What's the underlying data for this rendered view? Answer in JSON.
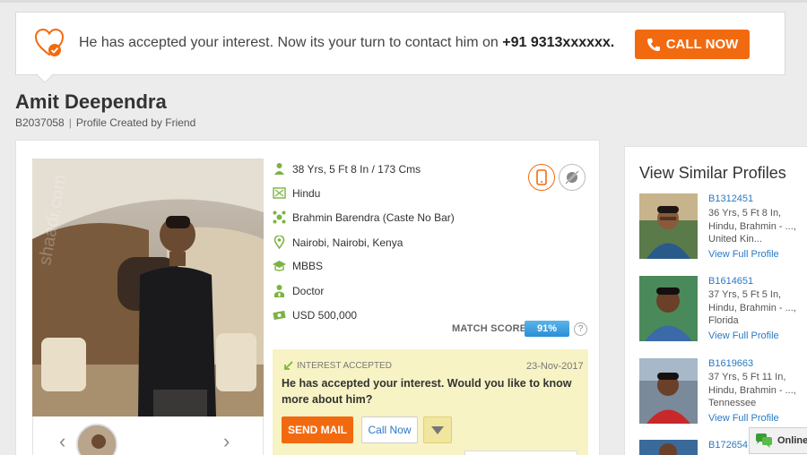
{
  "notice": {
    "text": "He has accepted your interest. Now its your turn to contact him on",
    "phone": "+91 9313xxxxxx.",
    "call_button": "CALL NOW"
  },
  "profile": {
    "name": "Amit Deependra",
    "id": "B2037058",
    "created_by": "Profile Created by Friend",
    "photo_watermark": "shaadi.com",
    "details": [
      {
        "icon": "person-icon",
        "text": "38 Yrs, 5 Ft 8 In / 173 Cms"
      },
      {
        "icon": "religion-icon",
        "text": "Hindu"
      },
      {
        "icon": "community-icon",
        "text": "Brahmin Barendra (Caste No Bar)"
      },
      {
        "icon": "location-icon",
        "text": "Nairobi, Nairobi, Kenya"
      },
      {
        "icon": "education-icon",
        "text": "MBBS"
      },
      {
        "icon": "profession-icon",
        "text": "Doctor"
      },
      {
        "icon": "income-icon",
        "text": "USD 500,000"
      }
    ]
  },
  "match": {
    "label": "MATCH SCORE",
    "score": "91%",
    "help": "?"
  },
  "interest": {
    "tag": "INTEREST ACCEPTED",
    "date": "23-Nov-2017",
    "message": "He has accepted your interest. Would you like to know more about him?",
    "send_mail": "SEND MAIL",
    "call_now": "Call Now"
  },
  "similar": {
    "title": "View Similar Profiles",
    "items": [
      {
        "id": "B1312451",
        "desc": "36 Yrs, 5 Ft 8 In, Hindu, Brahmin - ..., United Kin...",
        "link": "View Full Profile"
      },
      {
        "id": "B1614651",
        "desc": "37 Yrs, 5 Ft 5 In, Hindu, Brahmin - ..., Florida",
        "link": "View Full Profile"
      },
      {
        "id": "B1619663",
        "desc": "37 Yrs, 5 Ft 11 In, Hindu, Brahmin - ..., Tennessee",
        "link": "View Full Profile"
      },
      {
        "id": "B172654",
        "desc": "",
        "link": ""
      }
    ]
  },
  "chat": {
    "label": "Online"
  },
  "colors": {
    "accent": "#f26a10",
    "link": "#2a7ac4",
    "interest_bg": "#f7f3c4",
    "icon_green": "#7cb342"
  }
}
